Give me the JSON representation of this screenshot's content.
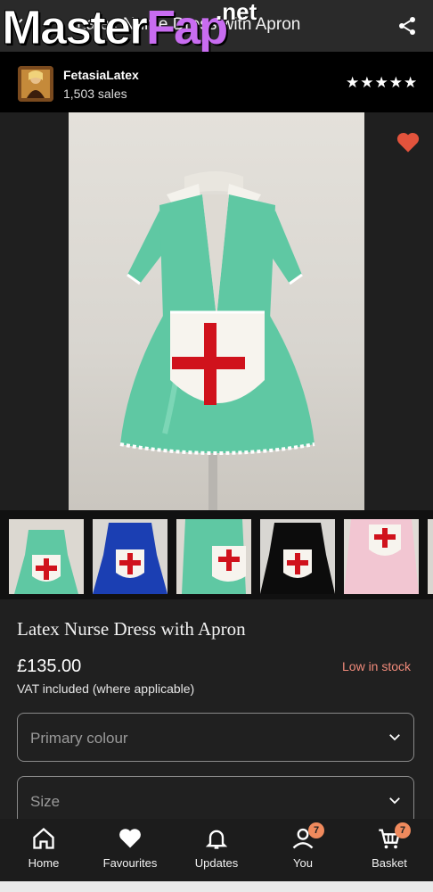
{
  "header": {
    "title": "Latex Nurse Dress with Apron",
    "watermark_main": "Master",
    "watermark_accent": "Fap",
    "watermark_suffix": ".net"
  },
  "shop": {
    "name": "FetasiaLatex",
    "sales": "1,503 sales",
    "rating_stars": "★★★★★",
    "rating_value": 5
  },
  "thumbnails": [
    {
      "label": "thumbnail-1",
      "dress_color": "#5fc8a3",
      "selected": true
    },
    {
      "label": "thumbnail-2",
      "dress_color": "#1b3fb3"
    },
    {
      "label": "thumbnail-3",
      "dress_color": "#5fc8a3"
    },
    {
      "label": "thumbnail-4",
      "dress_color": "#0c0c0c"
    },
    {
      "label": "thumbnail-5",
      "dress_color": "#f2c6d2"
    }
  ],
  "product": {
    "title": "Latex Nurse Dress with Apron",
    "price": "£135.00",
    "stock_status": "Low in stock",
    "vat_note": "VAT included (where applicable)"
  },
  "options": {
    "primary_colour_placeholder": "Primary colour",
    "size_placeholder": "Size"
  },
  "bottom_nav": {
    "home": "Home",
    "favourites": "Favourites",
    "updates": "Updates",
    "you": "You",
    "basket": "Basket",
    "you_badge": "7",
    "basket_badge": "7"
  },
  "colors": {
    "accent_red": "#e2533c",
    "stock_text": "#f08a7a",
    "badge": "#f08a5d",
    "dress_green": "#5fc8a3",
    "cross_red": "#d0121c"
  }
}
